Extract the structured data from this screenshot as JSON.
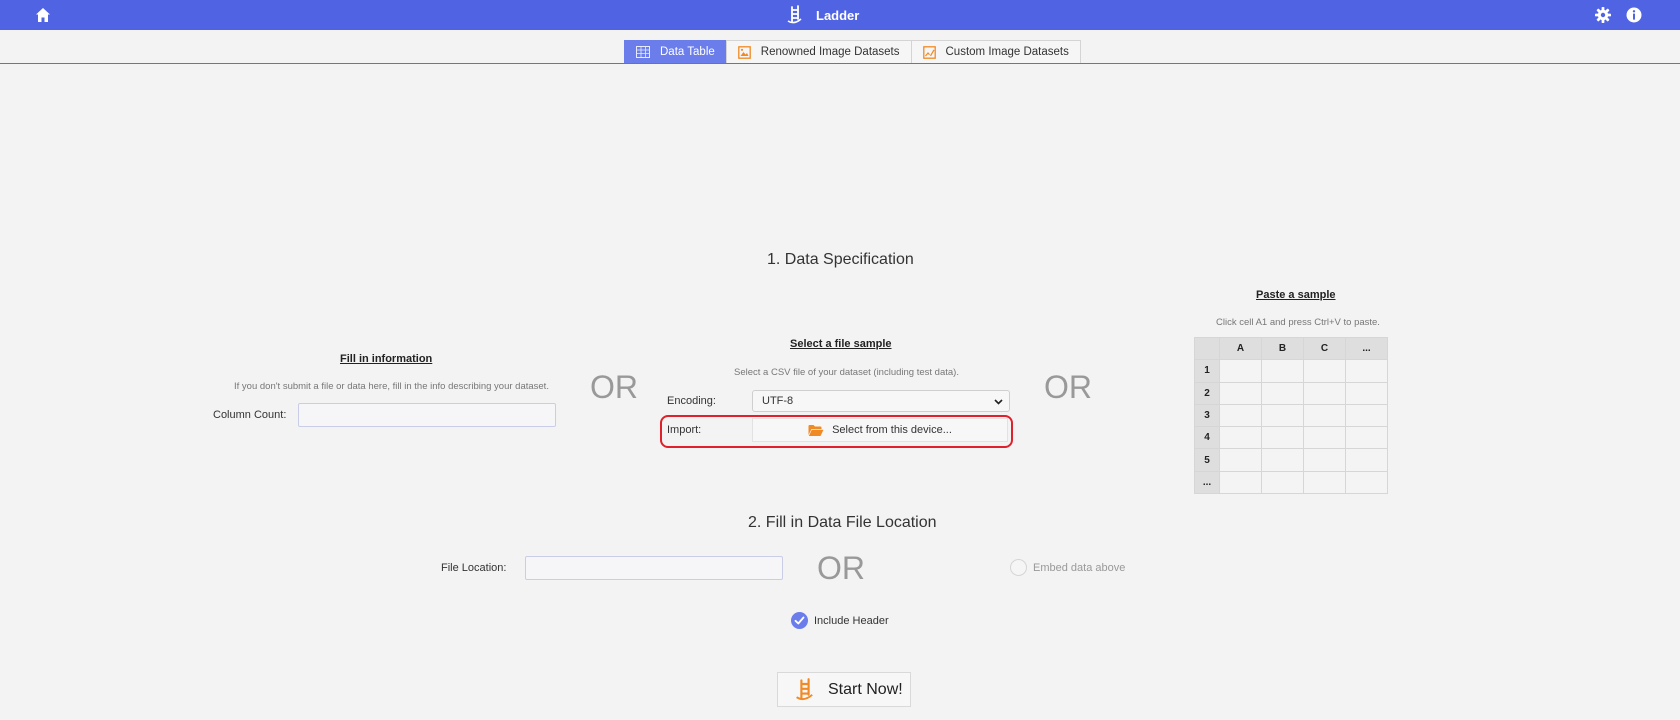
{
  "header": {
    "title": "Ladder",
    "home_icon": "home-icon",
    "logo_icon": "ladder-logo-icon",
    "settings_icon": "gear-icon",
    "info_icon": "info-icon",
    "bar_color": "#4f63e3"
  },
  "tabs": [
    {
      "label": "Data Table",
      "icon": "table-icon",
      "active": true
    },
    {
      "label": "Renowned Image Datasets",
      "icon": "image-icon",
      "active": false
    },
    {
      "label": "Custom Image Datasets",
      "icon": "image-edit-icon",
      "active": false
    }
  ],
  "section1": {
    "title": "1. Data Specification",
    "or_text": "OR",
    "fill_info": {
      "heading": "Fill in information",
      "hint": "If you don't submit a file or data here, fill in the info describing your dataset.",
      "column_count_label": "Column Count:",
      "column_count_value": ""
    },
    "file_sample": {
      "heading": "Select a file sample",
      "hint": "Select a CSV file of your dataset (including test data).",
      "encoding_label": "Encoding:",
      "encoding_value": "UTF-8",
      "import_label": "Import:",
      "import_button": "Select from this device...",
      "import_icon": "folder-open-icon"
    },
    "paste_sample": {
      "heading": "Paste a sample",
      "hint": "Click cell A1 and press Ctrl+V to paste.",
      "columns": [
        "A",
        "B",
        "C",
        "..."
      ],
      "rows": [
        "1",
        "2",
        "3",
        "4",
        "5",
        "..."
      ]
    }
  },
  "section2": {
    "title": "2. Fill in Data File Location",
    "file_location_label": "File Location:",
    "file_location_value": "",
    "or_text": "OR",
    "embed_label": "Embed data above",
    "embed_checked": false,
    "include_header_label": "Include Header",
    "include_header_checked": true
  },
  "start": {
    "label": "Start Now!",
    "icon": "ladder-logo-icon"
  },
  "colors": {
    "accent": "#6a7dea",
    "orange": "#f08a24",
    "highlight": "#e0202a"
  }
}
